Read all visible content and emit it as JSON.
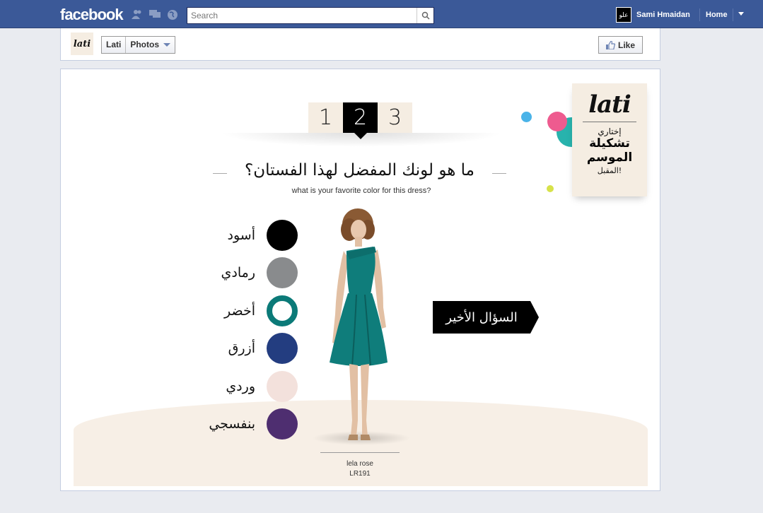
{
  "topbar": {
    "logo": "facebook",
    "search_placeholder": "Search",
    "user_name": "Sami Hmaidan",
    "avatar_text": "علو",
    "home_label": "Home"
  },
  "page_header": {
    "logo_text": "lati",
    "crumb_page": "Lati",
    "crumb_section": "Photos",
    "like_label": "Like"
  },
  "quiz": {
    "steps": [
      "1",
      "2",
      "3"
    ],
    "active_step": "2",
    "question_ar": "ما هو لونك المفضل لهذا الفستان؟",
    "question_en": "what is your favorite color for this dress?",
    "colors": [
      {
        "label": "أسود",
        "hex": "#000000",
        "style": "filled"
      },
      {
        "label": "رمادي",
        "hex": "#898b8d",
        "style": "filled"
      },
      {
        "label": "أخضر",
        "hex": "#0b7a78",
        "style": "ring"
      },
      {
        "label": "أزرق",
        "hex": "#233d80",
        "style": "filled"
      },
      {
        "label": "وردي",
        "hex": "#f3e1dc",
        "style": "filled"
      },
      {
        "label": "بنفسجي",
        "hex": "#4e2e70",
        "style": "filled"
      }
    ],
    "designer_name": "lela rose",
    "designer_code": "LR191",
    "last_question_label": "السؤال الأخير",
    "dress_color": "#0f7d7b"
  },
  "badge": {
    "logo": "lati",
    "line1": "إختاري",
    "line2": "تشكيلة",
    "line3": "الموسم",
    "line4": "المقبل!"
  },
  "colors": {
    "fb_blue": "#3b5998",
    "ground": "#f7efe6",
    "dot_blue": "#4ab3e8",
    "dot_pink": "#ee5b8f",
    "dot_teal": "#28b3ad",
    "dot_yellow": "#d7e24a"
  }
}
